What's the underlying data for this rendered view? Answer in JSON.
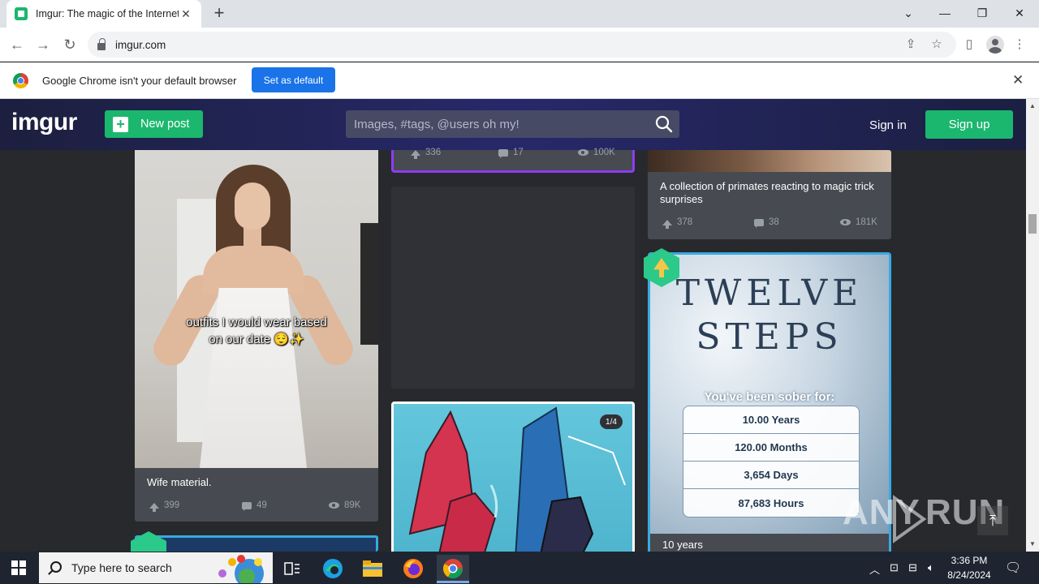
{
  "browser": {
    "tab_title": "Imgur: The magic of the Internet",
    "tab_close": "✕",
    "new_tab": "+",
    "url": "imgur.com",
    "infobar_text": "Google Chrome isn't your default browser",
    "set_default_label": "Set as default",
    "infobar_close": "✕",
    "window_controls": {
      "dropdown": "⌄",
      "minimize": "—",
      "restore": "❐",
      "close": "✕"
    }
  },
  "imgur": {
    "logo": "imgur",
    "new_post_label": "New post",
    "search_placeholder": "Images, #tags, @users oh my!",
    "sign_in": "Sign in",
    "sign_up": "Sign up"
  },
  "posts": {
    "girl": {
      "caption_line1": "outfits I would wear based",
      "caption_line2": "on our date 😌✨",
      "title": "Wife material.",
      "upvotes": "399",
      "comments": "49",
      "views": "89K"
    },
    "mid_top": {
      "upvotes": "336",
      "comments": "17",
      "views": "100K"
    },
    "dragon": {
      "badge": "1/4"
    },
    "primates": {
      "title": "A collection of primates reacting to magic trick surprises",
      "upvotes": "378",
      "comments": "38",
      "views": "181K"
    },
    "twelve_steps": {
      "title_line1": "TWELVE",
      "title_line2": "STEPS",
      "subtitle": "You've been sober for:",
      "rows": [
        "10.00 Years",
        "120.00 Months",
        "3,654 Days",
        "87,683 Hours"
      ],
      "footer": "10 years"
    }
  },
  "watermark": {
    "text": "ANY",
    "text2": "RUN"
  },
  "taskbar": {
    "search_placeholder": "Type here to search",
    "time": "3:36 PM",
    "date": "8/24/2024"
  },
  "colors": {
    "imgur_green": "#1bb76e",
    "chrome_blue": "#1a73e8",
    "purple_border": "#8d3cf5",
    "blue_border": "#39a9e0"
  }
}
